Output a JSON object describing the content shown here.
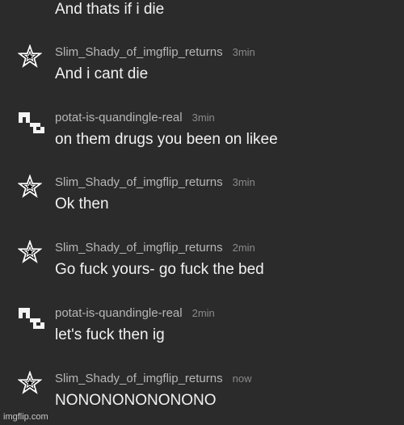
{
  "messages": [
    {
      "avatar": "star-icon",
      "username": "",
      "time": "",
      "text": "And thats if i die"
    },
    {
      "avatar": "star-icon",
      "username": "Slim_Shady_of_imgflip_returns",
      "time": "3min",
      "text": "And i cant die"
    },
    {
      "avatar": "block-icon",
      "username": "potat-is-quandingle-real",
      "time": "3min",
      "text": "on them drugs you been on likee"
    },
    {
      "avatar": "star-icon",
      "username": "Slim_Shady_of_imgflip_returns",
      "time": "3min",
      "text": "Ok then"
    },
    {
      "avatar": "star-icon",
      "username": "Slim_Shady_of_imgflip_returns",
      "time": "2min",
      "text": "Go fuck yours- go fuck the bed"
    },
    {
      "avatar": "block-icon",
      "username": "potat-is-quandingle-real",
      "time": "2min",
      "text": "let's fuck then ig"
    },
    {
      "avatar": "star-icon",
      "username": "Slim_Shady_of_imgflip_returns",
      "time": "now",
      "text": "NONONONONONONO"
    }
  ],
  "watermark": "imgflip.com",
  "colors": {
    "background": "#2b2b2b",
    "username": "#b7b7b7",
    "time": "#8a8a8a",
    "text": "#f1f1f1"
  }
}
